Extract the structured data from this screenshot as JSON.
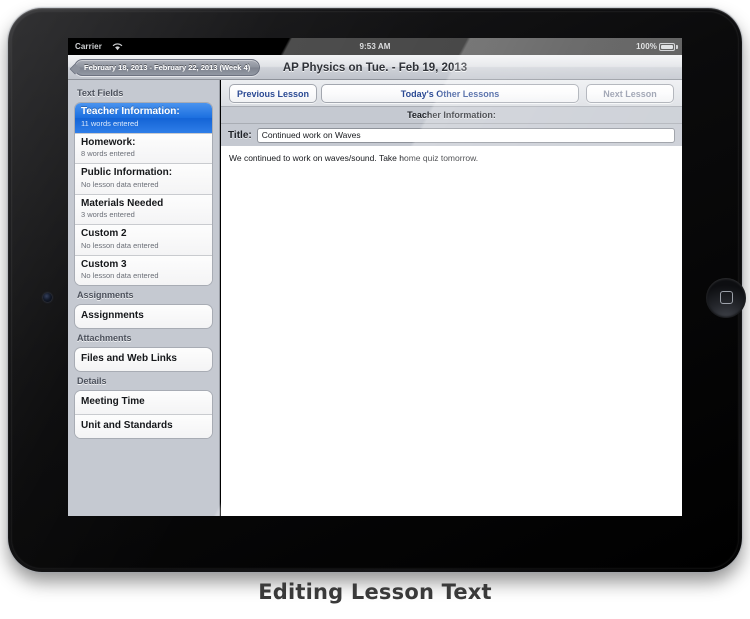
{
  "caption": "Editing Lesson Text",
  "colors": {
    "selected_row": "#1b6fe0",
    "sidebar_bg": "#c5c9d1",
    "button_text": "#2b4a94",
    "disabled_button_text": "#8e94a6"
  },
  "status_bar": {
    "carrier": "Carrier",
    "wifi_icon": "wifi-icon",
    "time": "9:53 AM",
    "battery_percent": "100%",
    "battery_icon": "battery-icon"
  },
  "navbar": {
    "date_range_button": "February 18, 2013 - February 22, 2013 (Week 4)",
    "title": "AP Physics on Tue. - Feb 19, 2013"
  },
  "sidebar": {
    "sections": [
      {
        "header": "Text Fields",
        "items": [
          {
            "title": "Teacher Information:",
            "subtitle": "11 words entered",
            "selected": true
          },
          {
            "title": "Homework:",
            "subtitle": "8 words entered",
            "selected": false
          },
          {
            "title": "Public Information:",
            "subtitle": "No lesson data entered",
            "selected": false
          },
          {
            "title": "Materials Needed",
            "subtitle": "3 words entered",
            "selected": false
          },
          {
            "title": "Custom 2",
            "subtitle": "No lesson data entered",
            "selected": false
          },
          {
            "title": "Custom 3",
            "subtitle": "No lesson data entered",
            "selected": false
          }
        ]
      },
      {
        "header": "Assignments",
        "items": [
          {
            "title": "Assignments",
            "subtitle": "",
            "selected": false
          }
        ]
      },
      {
        "header": "Attachments",
        "items": [
          {
            "title": "Files and Web Links",
            "subtitle": "",
            "selected": false
          }
        ]
      },
      {
        "header": "Details",
        "items": [
          {
            "title": "Meeting Time",
            "subtitle": "",
            "selected": false
          },
          {
            "title": "Unit and Standards",
            "subtitle": "",
            "selected": false
          }
        ]
      }
    ]
  },
  "detail": {
    "toolbar": {
      "previous_lesson": "Previous Lesson",
      "todays_other_lessons": "Today's Other Lessons",
      "next_lesson": "Next Lesson"
    },
    "field_header": "Teacher Information:",
    "title_label": "Title:",
    "title_value": "Continued work on Waves",
    "body_text": "We continued to work on waves/sound.  Take home quiz tomorrow."
  }
}
